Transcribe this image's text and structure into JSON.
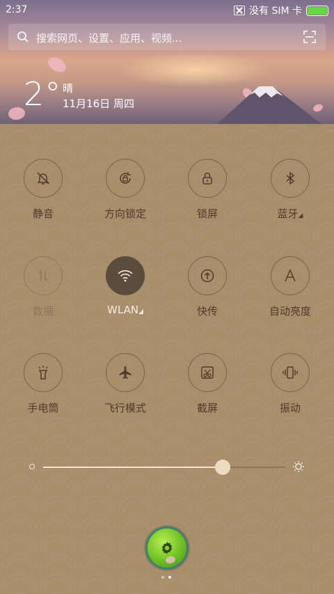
{
  "status": {
    "time": "2:37",
    "sim_text": "没有 SIM 卡",
    "battery_color": "#5fdc3a"
  },
  "search": {
    "placeholder": "搜索网页、设置、应用、视频..."
  },
  "weather": {
    "temperature": "2°",
    "condition": "晴",
    "date": "11月16日 周四"
  },
  "toggles": [
    {
      "label": "静音",
      "icon": "bell-off-icon",
      "state": "off"
    },
    {
      "label": "方向锁定",
      "icon": "rotation-lock-icon",
      "state": "off"
    },
    {
      "label": "锁屏",
      "icon": "lock-icon",
      "state": "off"
    },
    {
      "label": "蓝牙",
      "icon": "bluetooth-icon",
      "state": "off"
    },
    {
      "label": "数据",
      "icon": "data-arrows-icon",
      "state": "disabled"
    },
    {
      "label": "WLAN",
      "icon": "wifi-icon",
      "state": "on"
    },
    {
      "label": "快传",
      "icon": "upload-icon",
      "state": "off"
    },
    {
      "label": "自动亮度",
      "icon": "auto-brightness-icon",
      "state": "off"
    },
    {
      "label": "手电筒",
      "icon": "flashlight-icon",
      "state": "off"
    },
    {
      "label": "飞行模式",
      "icon": "airplane-icon",
      "state": "off"
    },
    {
      "label": "截屏",
      "icon": "screenshot-icon",
      "state": "off"
    },
    {
      "label": "振动",
      "icon": "vibrate-icon",
      "state": "off"
    }
  ],
  "brightness": {
    "level": 0.74
  },
  "pager": {
    "pages": 2,
    "current": 2
  }
}
